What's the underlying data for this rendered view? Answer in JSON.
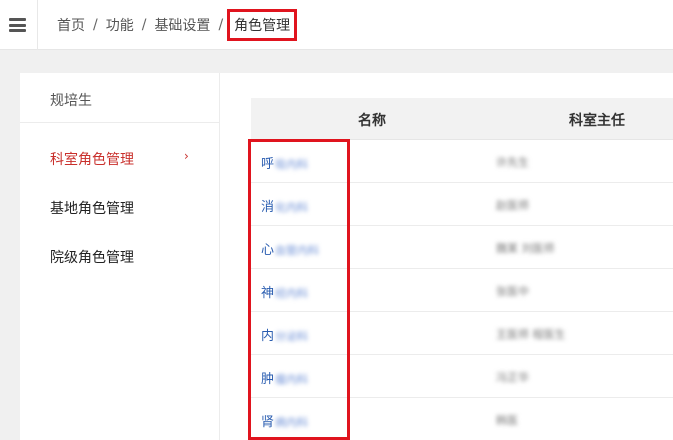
{
  "breadcrumb": {
    "items": [
      "首页",
      "功能",
      "基础设置"
    ],
    "separator": "/",
    "current": "角色管理"
  },
  "sidebar": {
    "title": "规培生",
    "items": [
      {
        "label": "科室角色管理",
        "active": true
      },
      {
        "label": "基地角色管理",
        "active": false
      },
      {
        "label": "院级角色管理",
        "active": false
      }
    ],
    "chevron": "›"
  },
  "table": {
    "headers": [
      "名称",
      "科室主任"
    ],
    "rows": [
      {
        "name_prefix": "呼",
        "name_rest": "吸内科",
        "director": "许先生"
      },
      {
        "name_prefix": "消",
        "name_rest": "化内科",
        "director": "赵医师"
      },
      {
        "name_prefix": "心",
        "name_rest": "血管内科",
        "director": "魏某 刘医师"
      },
      {
        "name_prefix": "神",
        "name_rest": "经内科",
        "director": "张医中"
      },
      {
        "name_prefix": "内",
        "name_rest": "分泌科",
        "director": "王医师 程医生"
      },
      {
        "name_prefix": "肿",
        "name_rest": "瘤内科",
        "director": "冯正华"
      },
      {
        "name_prefix": "肾",
        "name_rest": "病内科",
        "director": "韩医"
      }
    ]
  },
  "colors": {
    "highlight": "#e0141e",
    "active_menu": "#c9302c",
    "link": "#2a5db0"
  }
}
